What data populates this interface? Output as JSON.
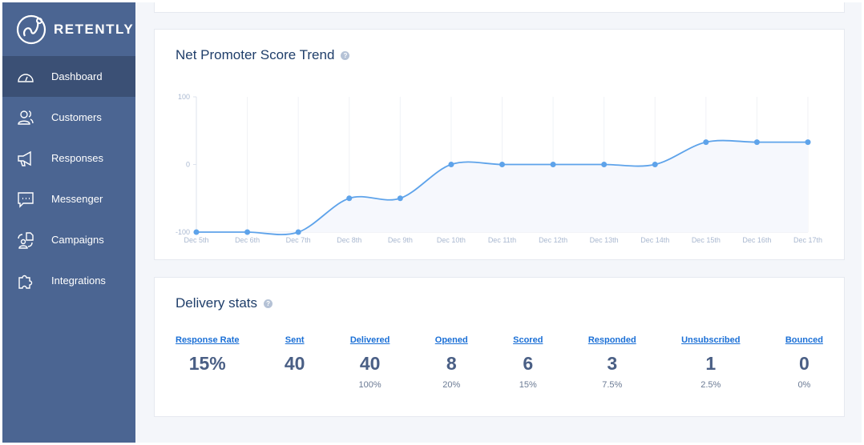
{
  "brand": {
    "name": "RETENTLY"
  },
  "sidebar": {
    "items": [
      {
        "label": "Dashboard",
        "icon": "dashboard-gauge-icon",
        "active": true
      },
      {
        "label": "Customers",
        "icon": "customers-icon"
      },
      {
        "label": "Responses",
        "icon": "megaphone-icon"
      },
      {
        "label": "Messenger",
        "icon": "chat-bubble-icon"
      },
      {
        "label": "Campaigns",
        "icon": "campaigns-icon"
      },
      {
        "label": "Integrations",
        "icon": "puzzle-icon"
      }
    ]
  },
  "nps": {
    "title": "Net Promoter Score Trend"
  },
  "chart_data": {
    "type": "area",
    "categories": [
      "Dec 5th",
      "Dec 6th",
      "Dec 7th",
      "Dec 8th",
      "Dec 9th",
      "Dec 10th",
      "Dec 11th",
      "Dec 12th",
      "Dec 13th",
      "Dec 14th",
      "Dec 15th",
      "Dec 16th",
      "Dec 17th"
    ],
    "values": [
      -100,
      -100,
      -100,
      -50,
      -50,
      0,
      0,
      0,
      0,
      0,
      33,
      33,
      33
    ],
    "ylim": [
      -100,
      100
    ],
    "yticks": [
      "100",
      "0",
      "-100"
    ],
    "grid": "vertical",
    "color": "#5ea3ea"
  },
  "delivery": {
    "title": "Delivery stats",
    "stats": [
      {
        "label": "Response Rate",
        "value": "15%",
        "pct": ""
      },
      {
        "label": "Sent",
        "value": "40",
        "pct": ""
      },
      {
        "label": "Delivered",
        "value": "40",
        "pct": "100%"
      },
      {
        "label": "Opened",
        "value": "8",
        "pct": "20%"
      },
      {
        "label": "Scored",
        "value": "6",
        "pct": "15%"
      },
      {
        "label": "Responded",
        "value": "3",
        "pct": "7.5%"
      },
      {
        "label": "Unsubscribed",
        "value": "1",
        "pct": "2.5%"
      },
      {
        "label": "Bounced",
        "value": "0",
        "pct": "0%"
      }
    ]
  }
}
